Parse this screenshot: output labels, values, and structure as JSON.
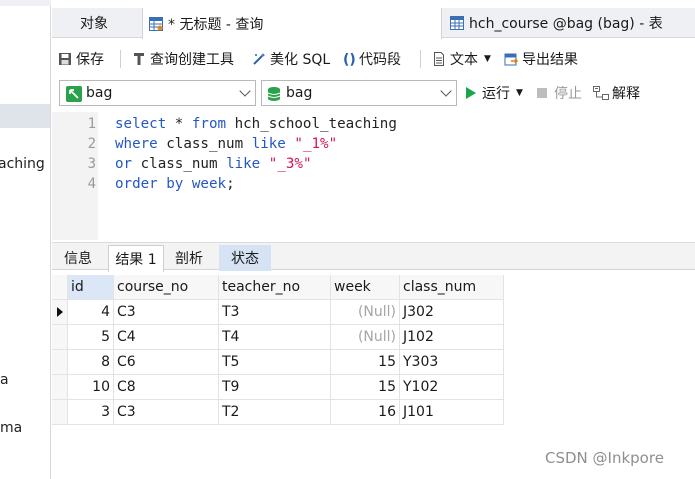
{
  "sidebar": {
    "items": [
      "aching",
      "a",
      "ma"
    ]
  },
  "tabs": [
    {
      "label": "对象",
      "active": false
    },
    {
      "label": "* 无标题 - 查询",
      "active": true
    },
    {
      "label": "hch_course @bag (bag) - 表",
      "active": false
    }
  ],
  "toolbar": {
    "save": "保存",
    "query_builder": "查询创建工具",
    "beautify": "美化 SQL",
    "snippet": "代码段",
    "text": "文本",
    "export": "导出结果"
  },
  "selectors": {
    "connection": "bag",
    "database": "bag",
    "run": "运行",
    "stop": "停止",
    "explain": "解释"
  },
  "editor": {
    "line_numbers": [
      "1",
      "2",
      "3",
      "4"
    ]
  },
  "result_tabs": [
    "信息",
    "结果 1",
    "剖析",
    "状态"
  ],
  "grid": {
    "columns": [
      "id",
      "course_no",
      "teacher_no",
      "week",
      "class_num"
    ],
    "rows": [
      [
        "4",
        "C3",
        "T3",
        "(Null)",
        "J302"
      ],
      [
        "5",
        "C4",
        "T4",
        "(Null)",
        "J102"
      ],
      [
        "8",
        "C6",
        "T5",
        "15",
        "Y303"
      ],
      [
        "10",
        "C8",
        "T9",
        "15",
        "Y102"
      ],
      [
        "3",
        "C3",
        "T2",
        "16",
        "J101"
      ]
    ]
  },
  "watermark": "CSDN @Inkpore",
  "colors": {
    "keyword": "#2457c5",
    "string": "#d4165a",
    "run_green": "#1aa64b",
    "status_tab": "#d6e3f5"
  }
}
